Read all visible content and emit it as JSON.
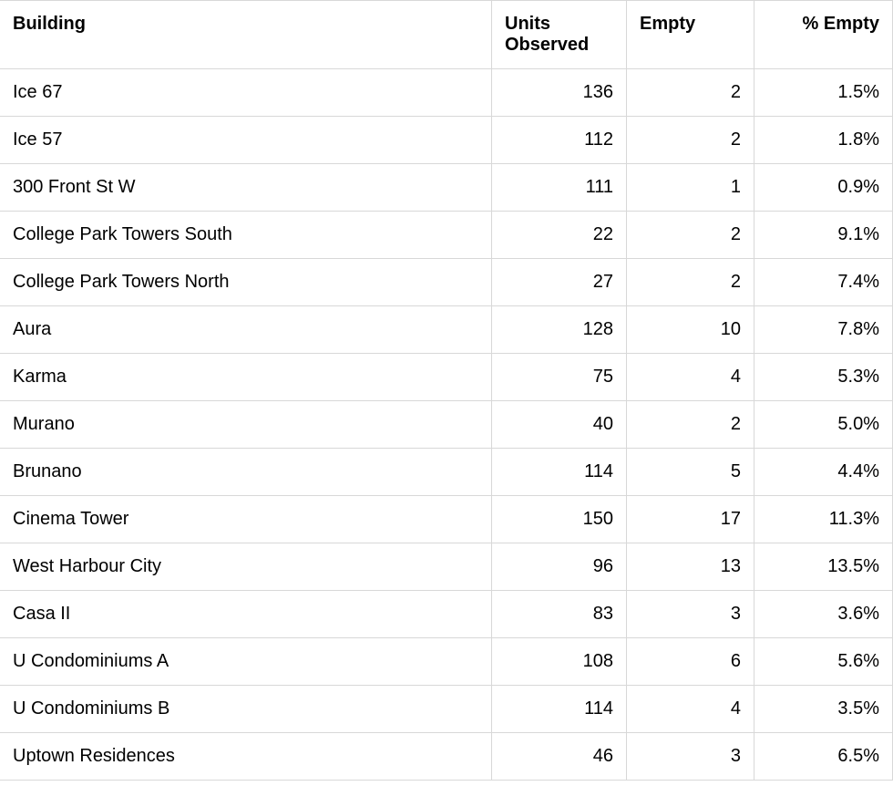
{
  "chart_data": {
    "type": "table",
    "columns": [
      "Building",
      "Units Observed",
      "Empty",
      "% Empty"
    ],
    "rows": [
      [
        "Ice 67",
        136,
        2,
        "1.5%"
      ],
      [
        "Ice 57",
        112,
        2,
        "1.8%"
      ],
      [
        "300 Front St W",
        111,
        1,
        "0.9%"
      ],
      [
        "College Park Towers South",
        22,
        2,
        "9.1%"
      ],
      [
        "College Park Towers North",
        27,
        2,
        "7.4%"
      ],
      [
        "Aura",
        128,
        10,
        "7.8%"
      ],
      [
        "Karma",
        75,
        4,
        "5.3%"
      ],
      [
        "Murano",
        40,
        2,
        "5.0%"
      ],
      [
        "Brunano",
        114,
        5,
        "4.4%"
      ],
      [
        "Cinema Tower",
        150,
        17,
        "11.3%"
      ],
      [
        "West Harbour City",
        96,
        13,
        "13.5%"
      ],
      [
        "Casa II",
        83,
        3,
        "3.6%"
      ],
      [
        "U Condominiums A",
        108,
        6,
        "5.6%"
      ],
      [
        "U Condominiums B",
        114,
        4,
        "3.5%"
      ],
      [
        "Uptown Residences",
        46,
        3,
        "6.5%"
      ]
    ]
  }
}
